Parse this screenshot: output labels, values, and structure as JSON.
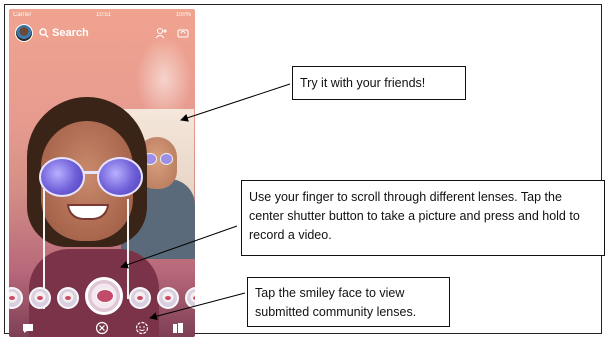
{
  "phone": {
    "status": {
      "carrier": "Carrier",
      "time": "10:51",
      "battery": "100%"
    },
    "search_label": "Search",
    "top_icons": [
      "add-friend-icon",
      "flip-camera-icon"
    ],
    "lenses": [
      "lens-1",
      "lens-2",
      "lens-3",
      "lens-active",
      "lens-5",
      "lens-6",
      "lens-7"
    ],
    "bottom_icons": [
      "chat-icon",
      "close-lens-icon",
      "community-lenses-smiley-icon",
      "stories-icon"
    ]
  },
  "callouts": {
    "friends": "Try it with your friends!",
    "scroll": "Use your finger to scroll through different lenses. Tap the center shutter button to take a picture and press and hold to record a video.",
    "smiley": "Tap the smiley face to view submitted community lenses."
  }
}
